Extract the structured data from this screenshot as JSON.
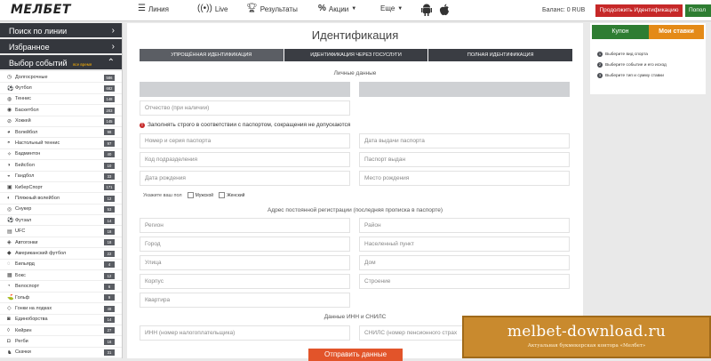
{
  "header": {
    "logo": "МЕЛБЕТ",
    "nav": [
      {
        "label": "Линия",
        "icon": "lines-icon"
      },
      {
        "label": "Live",
        "icon": "live-icon"
      },
      {
        "label": "Результаты",
        "icon": "trophy-icon"
      },
      {
        "label": "Акции",
        "icon": "percent-icon"
      },
      {
        "label": "Еще",
        "icon": "chevron-down-icon"
      }
    ],
    "balance": "Баланс: 0 RUB",
    "identify_button": "Продолжить Идентификацию",
    "topup_button": "Попол"
  },
  "sidebar": {
    "search": "Поиск по линии",
    "favorites": "Избранное",
    "events": "Выбор событий",
    "events_note": "все время",
    "sports": [
      {
        "label": "Долгосрочные",
        "count": "586"
      },
      {
        "label": "Футбол",
        "count": "682"
      },
      {
        "label": "Теннис",
        "count": "148"
      },
      {
        "label": "Баскетбол",
        "count": "203"
      },
      {
        "label": "Хоккей",
        "count": "145"
      },
      {
        "label": "Волейбол",
        "count": "98"
      },
      {
        "label": "Настольный теннис",
        "count": "97"
      },
      {
        "label": "Бадминтон",
        "count": "40"
      },
      {
        "label": "Бейсбол",
        "count": "10"
      },
      {
        "label": "Гандбол",
        "count": "33"
      },
      {
        "label": "КиберСпорт",
        "count": "171"
      },
      {
        "label": "Пляжный волейбол",
        "count": "12"
      },
      {
        "label": "Снукер",
        "count": "53"
      },
      {
        "label": "Футзал",
        "count": "14"
      },
      {
        "label": "UFC",
        "count": "18"
      },
      {
        "label": "Автогонки",
        "count": "18"
      },
      {
        "label": "Американский футбол",
        "count": "22"
      },
      {
        "label": "Бильярд",
        "count": "4"
      },
      {
        "label": "Бокс",
        "count": "12"
      },
      {
        "label": "Велоспорт",
        "count": "6"
      },
      {
        "label": "Гольф",
        "count": "9"
      },
      {
        "label": "Гонки на лодках",
        "count": "48"
      },
      {
        "label": "Единоборства",
        "count": "14"
      },
      {
        "label": "Кейрин",
        "count": "27"
      },
      {
        "label": "Регби",
        "count": "16"
      },
      {
        "label": "Скачки",
        "count": "31"
      }
    ]
  },
  "main": {
    "title": "Идентификация",
    "tabs": [
      "УПРОЩЁННАЯ ИДЕНТИФИКАЦИЯ",
      "ИДЕНТИФИКАЦИЯ ЧЕРЕЗ ГОСУСЛУГИ",
      "ПОЛНАЯ ИДЕНТИФИКАЦИЯ"
    ],
    "personal_title": "Личные данные",
    "patronymic": "Отчество (при наличии)",
    "warning": "Заполнять строго в соответствии с паспортом, сокращения не допускаются",
    "passport_number": "Номер и серия паспорта",
    "passport_date": "Дата выдачи паспорта",
    "division_code": "Код подразделения",
    "issued_by": "Паспорт выдан",
    "birth_date": "Дата рождения",
    "birth_place": "Место рождения",
    "gender_label": "Укажите ваш пол",
    "male": "Мужской",
    "female": "Женский",
    "address_title": "Адрес постоянной регистрации (последняя прописка в паспорте)",
    "region": "Регион",
    "district": "Район",
    "city": "Город",
    "locality": "Населенный пункт",
    "street": "Улица",
    "house": "Дом",
    "building": "Корпус",
    "structure": "Строение",
    "apartment": "Квартира",
    "inn_title": "Данные ИНН и СНИЛС",
    "inn": "ИНН (номер налогоплательщика)",
    "snils": "СНИЛС (номер пенсионного страх",
    "submit": "Отправить данные"
  },
  "coupon": {
    "tab1": "Купон",
    "tab2": "Мои ставки",
    "steps": [
      "Выберите вид спорта",
      "Выберите событие и его исход",
      "Выберите тип и сумму ставки"
    ]
  },
  "watermark": {
    "main": "melbet-download.ru",
    "sub": "Актуальная букмекерская контора «Мелбет»"
  }
}
